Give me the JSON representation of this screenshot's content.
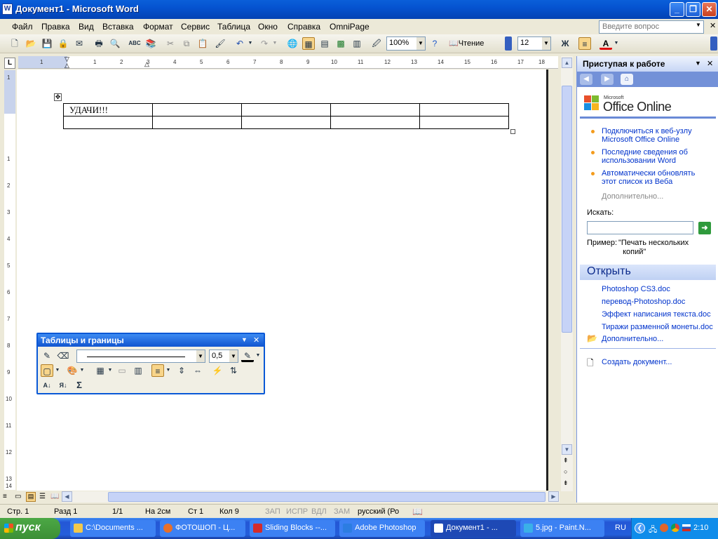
{
  "window": {
    "title": "Документ1 - Microsoft Word"
  },
  "menu": {
    "items": [
      "Файл",
      "Правка",
      "Вид",
      "Вставка",
      "Формат",
      "Сервис",
      "Таблица",
      "Окно",
      "Справка",
      "OmniPage"
    ],
    "ask_placeholder": "Введите вопрос"
  },
  "toolbar": {
    "zoom": "100%",
    "reading_label": "Чтение",
    "font_size": "12",
    "bold_label": "Ж",
    "color_letter": "A"
  },
  "ruler": {
    "h_numbers": [
      "1",
      "1",
      "2",
      "3",
      "4",
      "5",
      "6",
      "7",
      "8",
      "9",
      "10",
      "11",
      "12",
      "13",
      "14",
      "15",
      "16",
      "17",
      "18"
    ],
    "v_numbers": [
      "1",
      "1",
      "2",
      "3",
      "4",
      "5",
      "6",
      "7",
      "8",
      "9",
      "10",
      "11",
      "12",
      "13",
      "14"
    ]
  },
  "document": {
    "table": [
      [
        "УДАЧИ!!!",
        "",
        "",
        "",
        ""
      ],
      [
        "",
        "",
        "",
        "",
        ""
      ]
    ]
  },
  "task_pane": {
    "title": "Приступая к работе",
    "logo_small": "Microsoft",
    "logo_big": "Office Online",
    "links": [
      {
        "line1": "Подключиться к веб-узлу",
        "line2": "Microsoft Office Online"
      },
      {
        "line1": "Последние сведения об",
        "line2": "использовании Word"
      },
      {
        "line1": "Автоматически обновлять",
        "line2": "этот список из Веба"
      }
    ],
    "more1": "Дополнительно...",
    "search_label": "Искать:",
    "example_label": "Пример:",
    "example_text1": "\"Печать нескольких",
    "example_text2": "копий\"",
    "open_section": "Открыть",
    "files": [
      "Photoshop CS3.doc",
      "перевод-Photoshop.doc",
      "Эффект написания текста.doc",
      "Тиражи разменной монеты.doc"
    ],
    "more2": "Дополнительно...",
    "create": "Создать документ..."
  },
  "floating_toolbar": {
    "title": "Таблицы и границы",
    "line_width": "0,5",
    "sum_symbol": "Σ"
  },
  "status": {
    "page": "Стр. 1",
    "section": "Разд 1",
    "pages": "1/1",
    "at": "На 2см",
    "line": "Ст 1",
    "col": "Кол 9",
    "rec": "ЗАП",
    "trk": "ИСПР",
    "ext": "ВДЛ",
    "ovr": "ЗАМ",
    "lang": "русский (Ро"
  },
  "taskbar": {
    "start": "пуск",
    "tasks": [
      "C:\\Documents ...",
      "ФОТОШОП - Ц...",
      "Sliding Blocks --...",
      "Adobe Photoshop",
      "Документ1 - ...",
      "5.jpg - Paint.N..."
    ],
    "lang": "RU",
    "clock": "2:10"
  }
}
